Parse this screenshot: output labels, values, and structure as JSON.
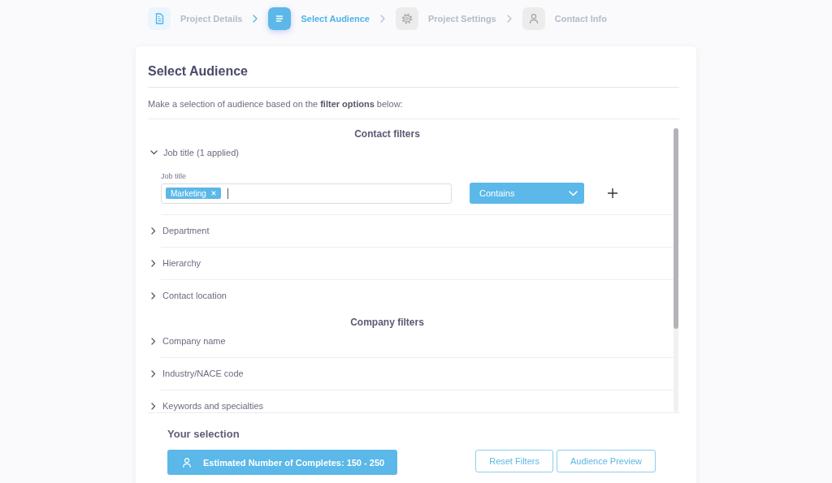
{
  "steps": [
    {
      "kind": "document",
      "label": "Project Details",
      "completed": true,
      "selected": false
    },
    {
      "kind": "list",
      "label": "Select Audience",
      "completed": false,
      "selected": true
    },
    {
      "kind": "gear",
      "label": "Project Settings",
      "completed": false,
      "selected": false
    },
    {
      "kind": "person",
      "label": "Contact Info",
      "completed": false,
      "selected": false
    }
  ],
  "panel": {
    "title": "Select Audience",
    "description": "Make a selection of audience based on the **filter options** below:"
  },
  "filter_groups": [
    {
      "title": "Contact filters",
      "filters": [
        {
          "label": "Job title (1 applied)",
          "expanded": true,
          "field": {
            "label": "Job title",
            "tags": [
              "Marketing"
            ],
            "focused": true
          },
          "operator": "Contains"
        },
        {
          "label": "Department",
          "expanded": false
        },
        {
          "label": "Hierarchy",
          "expanded": false
        },
        {
          "label": "Contact location",
          "expanded": false
        }
      ]
    },
    {
      "title": "Company filters",
      "filters": [
        {
          "label": "Company name",
          "expanded": false
        },
        {
          "label": "Industry/NACE code",
          "expanded": false
        },
        {
          "label": "Keywords and specialties",
          "expanded": false
        }
      ]
    }
  ],
  "selection": {
    "title": "Your selection",
    "estimate": "Estimated Number of Completes: 150 - 250",
    "buttons": [
      "Reset Filters",
      "Audience Preview"
    ]
  }
}
